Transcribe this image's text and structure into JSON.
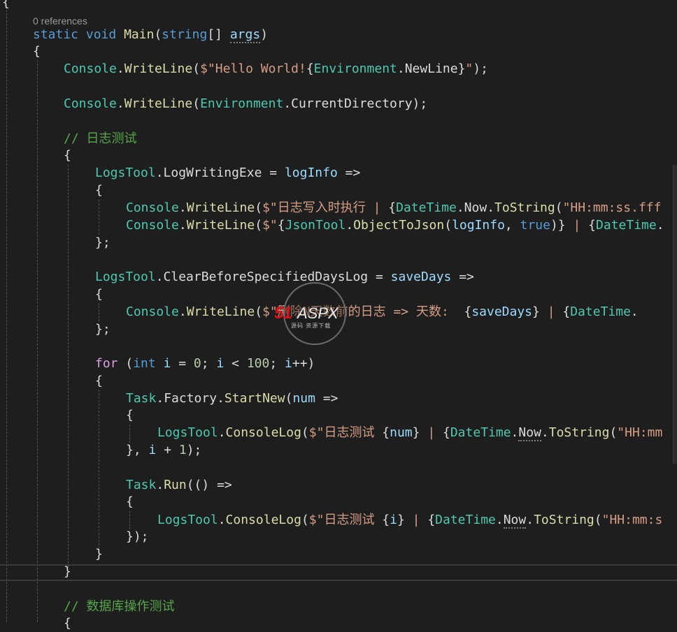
{
  "editor": {
    "codelens": "0 references",
    "lines": [
      [
        [
          "t-pl",
          "{"
        ]
      ],
      [
        [
          "t-kw",
          "static"
        ],
        [
          "t-pl",
          " "
        ],
        [
          "t-kw",
          "void"
        ],
        [
          "t-pl",
          " "
        ],
        [
          "t-mth",
          "Main"
        ],
        [
          "t-pl",
          "("
        ],
        [
          "t-kw",
          "string"
        ],
        [
          "t-pl",
          "[] "
        ],
        [
          "t-var dots",
          "args"
        ],
        [
          "t-pl",
          ")"
        ]
      ],
      [
        [
          "t-pl",
          "{"
        ]
      ],
      [
        [
          "t-type",
          "Console"
        ],
        [
          "t-pl",
          "."
        ],
        [
          "t-mth",
          "WriteLine"
        ],
        [
          "t-pl",
          "("
        ],
        [
          "t-str",
          "$\"Hello World!"
        ],
        [
          "t-pl",
          "{"
        ],
        [
          "t-type",
          "Environment"
        ],
        [
          "t-pl",
          "."
        ],
        [
          "t-pl",
          "NewLine"
        ],
        [
          "t-pl",
          "}"
        ],
        [
          "t-str",
          "\""
        ],
        [
          "t-pl",
          ");"
        ]
      ],
      [
        [
          "t-type",
          "Console"
        ],
        [
          "t-pl",
          "."
        ],
        [
          "t-mth",
          "WriteLine"
        ],
        [
          "t-pl",
          "("
        ],
        [
          "t-type",
          "Environment"
        ],
        [
          "t-pl",
          "."
        ],
        [
          "t-pl",
          "CurrentDirectory"
        ],
        [
          "t-pl",
          ");"
        ]
      ],
      [
        [
          "t-cmt",
          "// 日志测试"
        ]
      ],
      [
        [
          "t-pl",
          "{"
        ]
      ],
      [
        [
          "t-type",
          "LogsTool"
        ],
        [
          "t-pl",
          "."
        ],
        [
          "t-pl",
          "LogWritingExe"
        ],
        [
          "t-pl",
          " = "
        ],
        [
          "t-var",
          "logInfo"
        ],
        [
          "t-pl",
          " =>"
        ]
      ],
      [
        [
          "t-pl",
          "{"
        ]
      ],
      [
        [
          "t-type",
          "Console"
        ],
        [
          "t-pl",
          "."
        ],
        [
          "t-mth",
          "WriteLine"
        ],
        [
          "t-pl",
          "("
        ],
        [
          "t-str",
          "$\"日志写入时执行 | "
        ],
        [
          "t-pl",
          "{"
        ],
        [
          "t-type",
          "DateTime"
        ],
        [
          "t-pl",
          "."
        ],
        [
          "t-pl",
          "Now"
        ],
        [
          "t-pl",
          "."
        ],
        [
          "t-mth",
          "ToString"
        ],
        [
          "t-pl",
          "("
        ],
        [
          "t-str",
          "\"HH:mm:ss.fff"
        ]
      ],
      [
        [
          "t-type",
          "Console"
        ],
        [
          "t-pl",
          "."
        ],
        [
          "t-mth",
          "WriteLine"
        ],
        [
          "t-pl",
          "("
        ],
        [
          "t-str",
          "$\""
        ],
        [
          "t-pl",
          "{"
        ],
        [
          "t-type",
          "JsonTool"
        ],
        [
          "t-pl",
          "."
        ],
        [
          "t-mth",
          "ObjectToJson"
        ],
        [
          "t-pl",
          "("
        ],
        [
          "t-var",
          "logInfo"
        ],
        [
          "t-pl",
          ", "
        ],
        [
          "t-kw",
          "true"
        ],
        [
          "t-pl",
          ")}"
        ],
        [
          "t-str",
          " | "
        ],
        [
          "t-pl",
          "{"
        ],
        [
          "t-type",
          "DateTime"
        ],
        [
          "t-pl",
          "."
        ]
      ],
      [
        [
          "t-pl",
          "};"
        ]
      ],
      [
        [
          "t-type",
          "LogsTool"
        ],
        [
          "t-pl",
          "."
        ],
        [
          "t-pl",
          "ClearBeforeSpecifiedDaysLog"
        ],
        [
          "t-pl",
          " = "
        ],
        [
          "t-var",
          "saveDays"
        ],
        [
          "t-pl",
          " =>"
        ]
      ],
      [
        [
          "t-pl",
          "{"
        ]
      ],
      [
        [
          "t-type",
          "Console"
        ],
        [
          "t-pl",
          "."
        ],
        [
          "t-mth",
          "WriteLine"
        ],
        [
          "t-pl",
          "("
        ],
        [
          "t-str",
          "$\"删除N天数前的日志 => 天数:  "
        ],
        [
          "t-pl",
          "{"
        ],
        [
          "t-var",
          "saveDays"
        ],
        [
          "t-pl",
          "}"
        ],
        [
          "t-str",
          " | "
        ],
        [
          "t-pl",
          "{"
        ],
        [
          "t-type",
          "DateTime"
        ],
        [
          "t-pl",
          "."
        ]
      ],
      [
        [
          "t-pl",
          "};"
        ]
      ],
      [
        [
          "t-ctl",
          "for"
        ],
        [
          "t-pl",
          " ("
        ],
        [
          "t-kw",
          "int"
        ],
        [
          "t-pl",
          " "
        ],
        [
          "t-var",
          "i"
        ],
        [
          "t-pl",
          " = "
        ],
        [
          "t-num",
          "0"
        ],
        [
          "t-pl",
          "; "
        ],
        [
          "t-var",
          "i"
        ],
        [
          "t-pl",
          " < "
        ],
        [
          "t-num",
          "100"
        ],
        [
          "t-pl",
          "; "
        ],
        [
          "t-var",
          "i"
        ],
        [
          "t-pl",
          "++)"
        ]
      ],
      [
        [
          "t-pl",
          "{"
        ]
      ],
      [
        [
          "t-type",
          "Task"
        ],
        [
          "t-pl",
          "."
        ],
        [
          "t-pl",
          "Factory"
        ],
        [
          "t-pl",
          "."
        ],
        [
          "t-mth",
          "StartNew"
        ],
        [
          "t-pl",
          "("
        ],
        [
          "t-var",
          "num"
        ],
        [
          "t-pl",
          " =>"
        ]
      ],
      [
        [
          "t-pl",
          "{"
        ]
      ],
      [
        [
          "t-type",
          "LogsTool"
        ],
        [
          "t-pl",
          "."
        ],
        [
          "t-mth",
          "ConsoleLog"
        ],
        [
          "t-pl",
          "("
        ],
        [
          "t-str",
          "$\"日志测试 "
        ],
        [
          "t-pl",
          "{"
        ],
        [
          "t-var",
          "num"
        ],
        [
          "t-pl",
          "}"
        ],
        [
          "t-str",
          " | "
        ],
        [
          "t-pl",
          "{"
        ],
        [
          "t-type",
          "DateTime"
        ],
        [
          "t-pl",
          "."
        ],
        [
          "t-pl dots",
          "Now"
        ],
        [
          "t-pl",
          "."
        ],
        [
          "t-mth",
          "ToString"
        ],
        [
          "t-pl",
          "("
        ],
        [
          "t-str",
          "\"HH:mm"
        ]
      ],
      [
        [
          "t-pl",
          "}, "
        ],
        [
          "t-var",
          "i"
        ],
        [
          "t-pl",
          " + "
        ],
        [
          "t-num",
          "1"
        ],
        [
          "t-pl",
          ");"
        ]
      ],
      [
        [
          "t-type",
          "Task"
        ],
        [
          "t-pl",
          "."
        ],
        [
          "t-mth",
          "Run"
        ],
        [
          "t-pl",
          "(() =>"
        ]
      ],
      [
        [
          "t-pl",
          "{"
        ]
      ],
      [
        [
          "t-type",
          "LogsTool"
        ],
        [
          "t-pl",
          "."
        ],
        [
          "t-mth",
          "ConsoleLog"
        ],
        [
          "t-pl",
          "("
        ],
        [
          "t-str",
          "$\"日志测试 "
        ],
        [
          "t-pl",
          "{"
        ],
        [
          "t-var",
          "i"
        ],
        [
          "t-pl",
          "}"
        ],
        [
          "t-str",
          " | "
        ],
        [
          "t-pl",
          "{"
        ],
        [
          "t-type",
          "DateTime"
        ],
        [
          "t-pl",
          "."
        ],
        [
          "t-pl dots",
          "Now"
        ],
        [
          "t-pl",
          "."
        ],
        [
          "t-mth",
          "ToString"
        ],
        [
          "t-pl",
          "("
        ],
        [
          "t-str",
          "\"HH:mm:s"
        ]
      ],
      [
        [
          "t-pl",
          "});"
        ]
      ],
      [
        [
          "t-pl",
          "}"
        ]
      ],
      [
        [
          "t-pl",
          "}"
        ]
      ],
      [
        [
          "t-cmt",
          "// 数据库操作测试"
        ]
      ],
      [
        [
          "t-pl",
          "{"
        ]
      ]
    ]
  },
  "watermark": {
    "logo_red": "51",
    "logo_white": "ASPX",
    "sub": "源码 资源下载"
  }
}
